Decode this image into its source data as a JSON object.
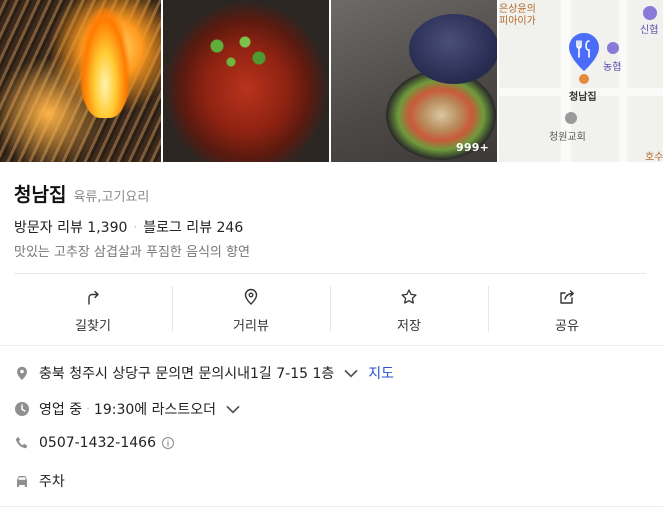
{
  "photos": {
    "count_badge": "999+",
    "map": {
      "labels": [
        "은상윤의",
        "피아이가",
        "신협",
        "농협",
        "청남집",
        "청원교회",
        "호수"
      ]
    }
  },
  "place": {
    "name": "청남집",
    "category": "육류,고기요리",
    "visitor_review_label": "방문자 리뷰 1,390",
    "blog_review_label": "블로그 리뷰 246",
    "tagline": "맛있는 고추장 삼겹살과 푸짐한 음식의 향연"
  },
  "actions": [
    {
      "label": "길찾기",
      "icon": "directions-icon"
    },
    {
      "label": "거리뷰",
      "icon": "street-view-icon"
    },
    {
      "label": "저장",
      "icon": "star-icon"
    },
    {
      "label": "공유",
      "icon": "share-icon"
    }
  ],
  "info": {
    "address": "충북 청주시 상당구 문의면 문의시내1길 7-15 1층",
    "map_link": "지도",
    "hours_status": "영업 중",
    "hours_detail": "19:30에 라스트오더",
    "phone": "0507-1432-1466",
    "parking": "주차"
  },
  "colors": {
    "accent_link": "#2a4fd6",
    "map_pin": "#4a6cf7"
  }
}
